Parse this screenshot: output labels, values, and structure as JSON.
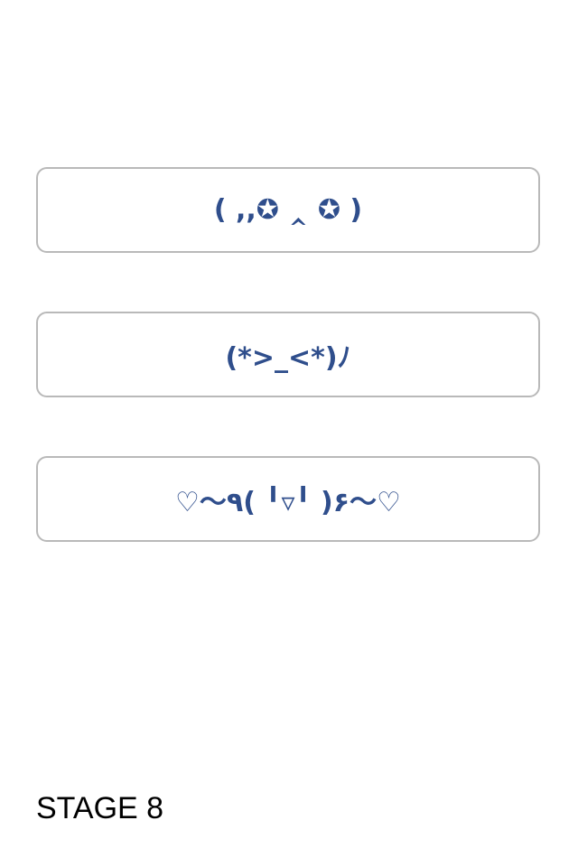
{
  "choices": [
    {
      "label": "( ,,✪ ‸ ✪ )"
    },
    {
      "label": "(*>_<*)ﾉ"
    },
    {
      "label": "♡〜٩( ╹▿╹ )۶〜♡"
    }
  ],
  "stage": {
    "label": "STAGE 8"
  },
  "colors": {
    "button_text": "#2f4e8c",
    "button_border": "#b9b9b9",
    "background": "#ffffff"
  }
}
